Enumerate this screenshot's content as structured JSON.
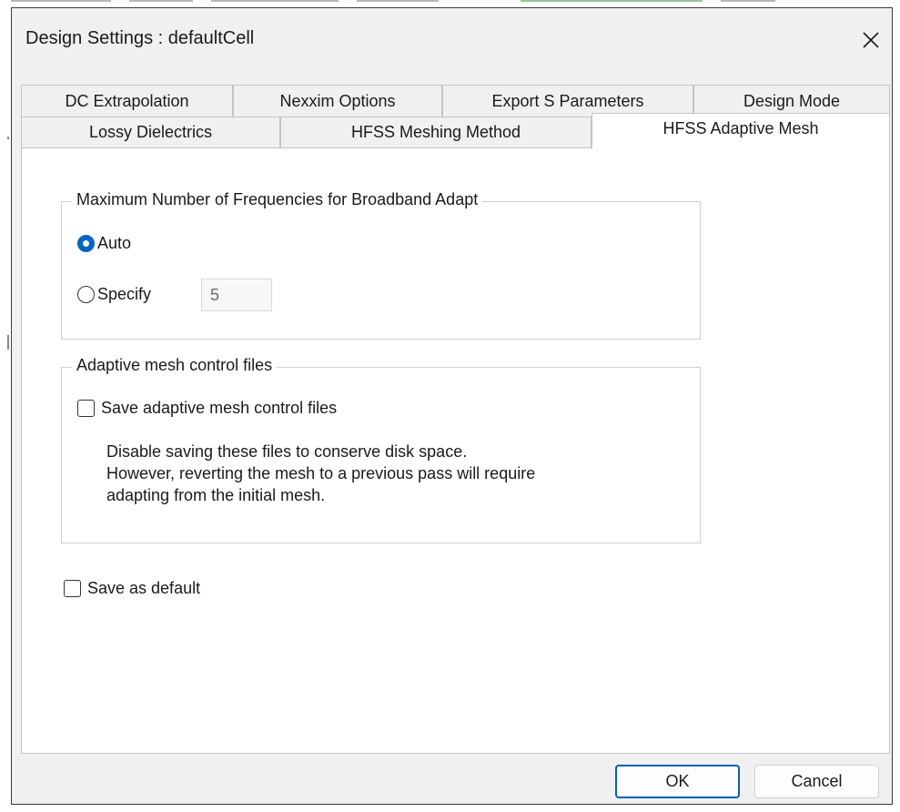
{
  "dialog": {
    "title": "Design Settings : defaultCell"
  },
  "tabs": {
    "row1": [
      "DC Extrapolation",
      "Nexxim Options",
      "Export S Parameters",
      "Design Mode"
    ],
    "row2": [
      "Lossy Dielectrics",
      "HFSS Meshing Method",
      "HFSS Adaptive Mesh"
    ],
    "active": "HFSS Adaptive Mesh"
  },
  "frequencies_group": {
    "title": "Maximum Number of Frequencies for Broadband Adapt",
    "auto_label": "Auto",
    "auto_selected": true,
    "specify_label": "Specify",
    "specify_value": "5"
  },
  "mesh_files_group": {
    "title": "Adaptive mesh control files",
    "save_label": "Save adaptive mesh control files",
    "save_checked": false,
    "note_lines": [
      "Disable saving these files to conserve disk space.",
      "However, reverting the mesh to a previous pass will require",
      "adapting from the initial mesh."
    ]
  },
  "save_default": {
    "label": "Save as default",
    "checked": false
  },
  "buttons": {
    "ok": "OK",
    "cancel": "Cancel"
  },
  "colors": {
    "accent": "#0067c0",
    "default_button_border": "#005fb8",
    "dialog_background": "#f0f0f0",
    "panel_background": "#ffffff"
  },
  "icons": {
    "close": "close-icon"
  }
}
